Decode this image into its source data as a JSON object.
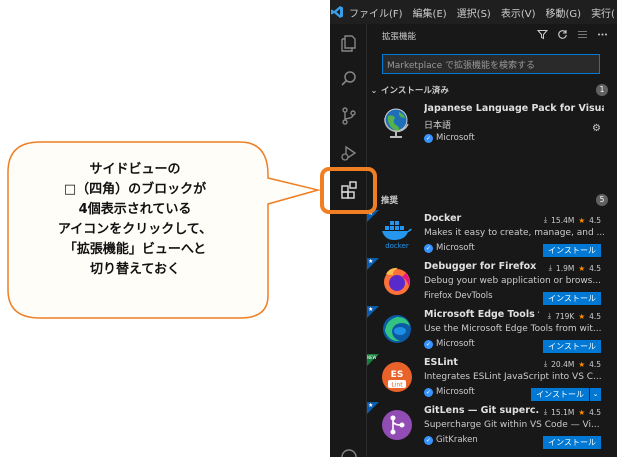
{
  "callout": {
    "lines": [
      "サイドビューの",
      "□（四角）のブロックが",
      "4個表示されている",
      "アイコンをクリックして、",
      "「拡張機能」ビューへと",
      "切り替えておく"
    ]
  },
  "menubar": {
    "items": [
      "ファイル(F)",
      "編集(E)",
      "選択(S)",
      "表示(V)",
      "移動(G)",
      "実行("
    ]
  },
  "sidebar": {
    "title": "拡張機能",
    "search_placeholder": "Marketplace で拡張機能を検索する",
    "installed": {
      "label": "インストール済み",
      "count": "1",
      "items": [
        {
          "name": "Japanese Language Pack for Visual ...",
          "description": "日本語",
          "publisher": "Microsoft"
        }
      ]
    },
    "recommended": {
      "label": "推奨",
      "count": "5",
      "items": [
        {
          "name": "Docker",
          "downloads": "15.4M",
          "rating": "4.5",
          "description": "Makes it easy to create, manage, and ...",
          "publisher": "Microsoft",
          "action": "インストール",
          "icon": "docker-icon"
        },
        {
          "name": "Debugger for Firefox",
          "downloads": "1.9M",
          "rating": "4.5",
          "description": "Debug your web application or brows...",
          "publisher": "Firefox DevTools",
          "action": "インストール",
          "icon": "firefox-icon"
        },
        {
          "name": "Microsoft Edge Tools f...",
          "downloads": "719K",
          "rating": "4.5",
          "description": "Use the Microsoft Edge Tools from wit...",
          "publisher": "Microsoft",
          "action": "インストール",
          "icon": "edge-icon"
        },
        {
          "name": "ESLint",
          "downloads": "20.4M",
          "rating": "4.5",
          "description": "Integrates ESLint JavaScript into VS C...",
          "publisher": "Microsoft",
          "action": "インストール",
          "icon": "eslint-icon",
          "badge": "NEW"
        },
        {
          "name": "GitLens — Git superc...",
          "downloads": "15.1M",
          "rating": "4.5",
          "description": "Supercharge Git within VS Code — Vi...",
          "publisher": "GitKraken",
          "action": "インストール",
          "icon": "gitlens-icon"
        }
      ]
    }
  },
  "colors": {
    "accent": "#0078d4",
    "callout_border": "#f07f24",
    "star": "#ff8e00"
  }
}
